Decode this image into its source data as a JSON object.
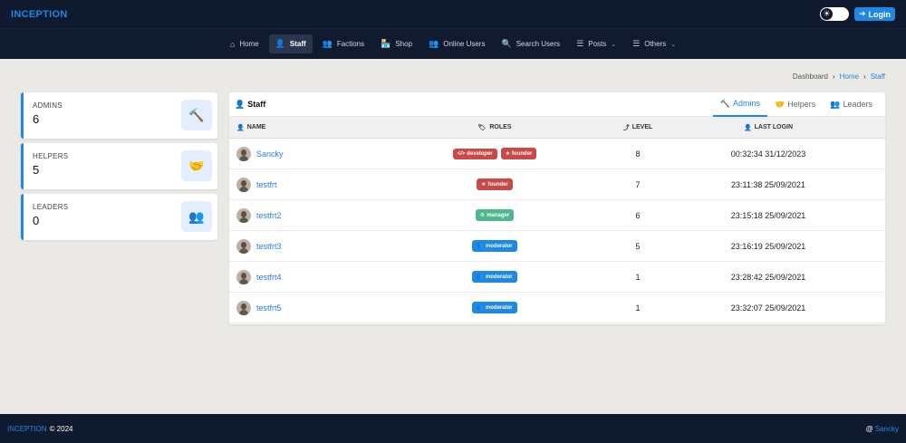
{
  "topbar": {
    "brand": "INCEPTION",
    "login_label": "Login",
    "theme_icon": "sun-icon"
  },
  "nav": [
    {
      "label": "Home",
      "icon": "⌂",
      "name": "home-icon",
      "caret": ""
    },
    {
      "label": "Staff",
      "icon": "👤",
      "name": "staff-icon",
      "caret": "",
      "active": true
    },
    {
      "label": "Factions",
      "icon": "👥",
      "name": "factions-icon",
      "caret": ""
    },
    {
      "label": "Shop",
      "icon": "🏪",
      "name": "shop-icon",
      "caret": ""
    },
    {
      "label": "Online Users",
      "icon": "👥",
      "name": "online-users-icon",
      "caret": ""
    },
    {
      "label": "Search Users",
      "icon": "🔍",
      "name": "search-icon",
      "caret": ""
    },
    {
      "label": "Posts",
      "icon": "☰",
      "name": "posts-icon",
      "caret": "⌄"
    },
    {
      "label": "Others",
      "icon": "☰",
      "name": "others-icon",
      "caret": "⌄"
    }
  ],
  "breadcrumb": {
    "items": [
      "Dashboard",
      "Home",
      "Staff"
    ]
  },
  "stats": [
    {
      "label": "ADMINS",
      "value": "6",
      "icon": "gavel-icon"
    },
    {
      "label": "HELPERS",
      "value": "5",
      "icon": "handshake-icon"
    },
    {
      "label": "LEADERS",
      "value": "0",
      "icon": "users-icon"
    }
  ],
  "panel": {
    "title": "Staff",
    "tabs": [
      {
        "label": "Admins",
        "active": true
      },
      {
        "label": "Helpers",
        "active": false
      },
      {
        "label": "Leaders",
        "active": false
      }
    ],
    "headers": {
      "name": "NAME",
      "roles": "ROLES",
      "level": "LEVEL",
      "last_login": "LAST LOGIN"
    },
    "rows": [
      {
        "name": "Sancky",
        "roles": [
          {
            "label": "developer",
            "icon": "</>",
            "color": "#c94848"
          },
          {
            "label": "founder",
            "icon": "★",
            "color": "#c94848"
          }
        ],
        "level": "8",
        "last_login": "00:32:34 31/12/2023"
      },
      {
        "name": "testfrt",
        "roles": [
          {
            "label": "founder",
            "icon": "★",
            "color": "#c94848"
          }
        ],
        "level": "7",
        "last_login": "23:11:38 25/09/2021"
      },
      {
        "name": "testfrt2",
        "roles": [
          {
            "label": "manager",
            "icon": "⚙",
            "color": "#4fb78d"
          }
        ],
        "level": "6",
        "last_login": "23:15:18 25/09/2021"
      },
      {
        "name": "testfrt3",
        "roles": [
          {
            "label": "moderator",
            "icon": "👥",
            "color": "#1e88e5"
          }
        ],
        "level": "5",
        "last_login": "23:16:19 25/09/2021"
      },
      {
        "name": "testfrt4",
        "roles": [
          {
            "label": "moderator",
            "icon": "👥",
            "color": "#1e88e5"
          }
        ],
        "level": "1",
        "last_login": "23:28:42 25/09/2021"
      },
      {
        "name": "testfrt5",
        "roles": [
          {
            "label": "moderator",
            "icon": "👥",
            "color": "#1e88e5"
          }
        ],
        "level": "1",
        "last_login": "23:32:07 25/09/2021"
      }
    ]
  },
  "footer": {
    "brand": "INCEPTION",
    "copyright": "© 2024",
    "author": "Sancky",
    "author_prefix": "@"
  },
  "colors": {
    "accent": "#1e88e5",
    "dark": "#0f1a2e",
    "danger": "#c94848",
    "success": "#4fb78d"
  }
}
